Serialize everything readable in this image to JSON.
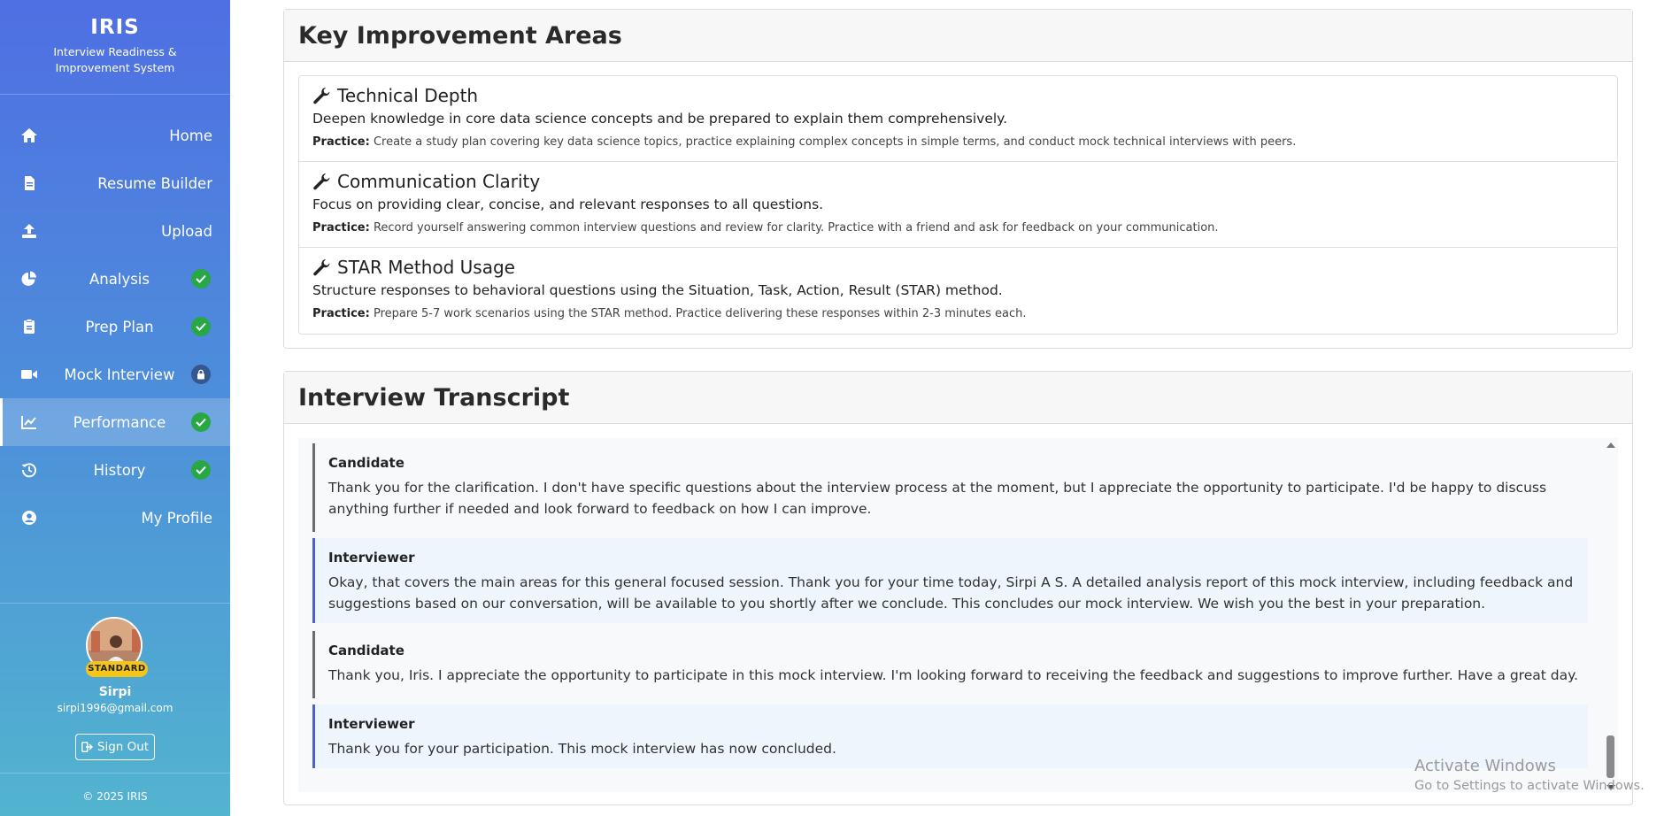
{
  "brand": {
    "title": "IRIS",
    "subtitle": "Interview Readiness & Improvement System"
  },
  "sidebar": {
    "items": [
      {
        "label": "Home",
        "icon": "home-icon",
        "status": "none"
      },
      {
        "label": "Resume Builder",
        "icon": "file-icon",
        "status": "none"
      },
      {
        "label": "Upload",
        "icon": "upload-icon",
        "status": "none"
      },
      {
        "label": "Analysis",
        "icon": "pie-chart-icon",
        "status": "complete"
      },
      {
        "label": "Prep Plan",
        "icon": "clipboard-icon",
        "status": "complete"
      },
      {
        "label": "Mock Interview",
        "icon": "video-camera-icon",
        "status": "locked"
      },
      {
        "label": "Performance",
        "icon": "line-chart-icon",
        "status": "complete",
        "active": true
      },
      {
        "label": "History",
        "icon": "history-icon",
        "status": "complete"
      },
      {
        "label": "My Profile",
        "icon": "user-circle-icon",
        "status": "none"
      }
    ]
  },
  "profile": {
    "plan": "STANDARD",
    "name": "Sirpi",
    "email": "sirpi1996@gmail.com",
    "signout_label": "Sign Out"
  },
  "footer": "© 2025 IRIS",
  "improvement": {
    "title": "Key Improvement Areas",
    "practice_label": "Practice:",
    "items": [
      {
        "title": "Technical Depth",
        "description": "Deepen knowledge in core data science concepts and be prepared to explain them comprehensively.",
        "practice": "Create a study plan covering key data science topics, practice explaining complex concepts in simple terms, and conduct mock technical interviews with peers."
      },
      {
        "title": "Communication Clarity",
        "description": "Focus on providing clear, concise, and relevant responses to all questions.",
        "practice": "Record yourself answering common interview questions and review for clarity. Practice with a friend and ask for feedback on your communication."
      },
      {
        "title": "STAR Method Usage",
        "description": "Structure responses to behavioral questions using the Situation, Task, Action, Result (STAR) method.",
        "practice": "Prepare 5-7 work scenarios using the STAR method. Practice delivering these responses within 2-3 minutes each."
      }
    ]
  },
  "transcript": {
    "title": "Interview Transcript",
    "messages": [
      {
        "speaker": "Candidate",
        "text": "Thank you for the clarification. I don't have specific questions about the interview process at the moment, but I appreciate the opportunity to participate. I'd be happy to discuss anything further if needed and look forward to feedback on how I can improve."
      },
      {
        "speaker": "Interviewer",
        "text": "Okay, that covers the main areas for this general focused session. Thank you for your time today, Sirpi A S. A detailed analysis report of this mock interview, including feedback and suggestions based on our conversation, will be available to you shortly after we conclude. This concludes our mock interview. We wish you the best in your preparation."
      },
      {
        "speaker": "Candidate",
        "text": "Thank you, Iris. I appreciate the opportunity to participate in this mock interview. I'm looking forward to receiving the feedback and suggestions to improve further. Have a great day."
      },
      {
        "speaker": "Interviewer",
        "text": "Thank you for your participation. This mock interview has now concluded."
      }
    ]
  },
  "watermark": {
    "line1": "Activate Windows",
    "line2": "Go to Settings to activate Windows."
  }
}
